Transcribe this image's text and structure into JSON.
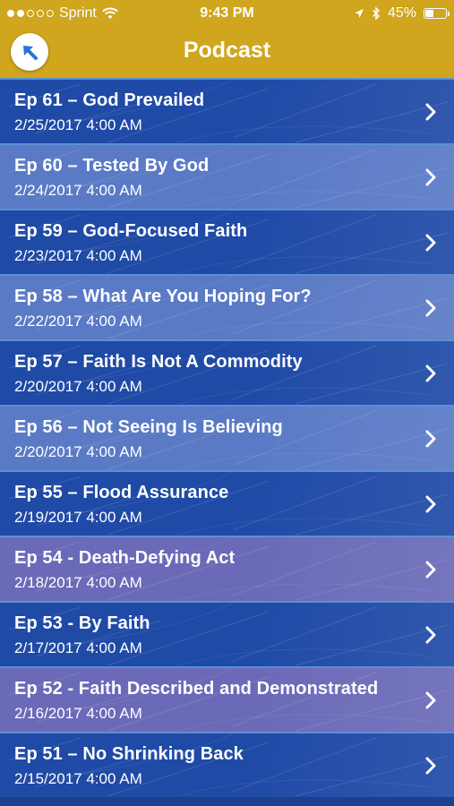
{
  "status_bar": {
    "carrier": "Sprint",
    "time": "9:43 PM",
    "battery_percent": "45%",
    "battery_level": 0.45,
    "signal_dots_filled": 2,
    "signal_dots_total": 5
  },
  "nav": {
    "title": "Podcast",
    "back_icon": "arrow-up-left-icon"
  },
  "colors": {
    "header": "#cfa61d",
    "row_dark": "#1f4aa6",
    "row_light": "#5a7ac6",
    "row_purple": "#6a6ab8",
    "row_divider": "#5c8fd6",
    "text": "#ffffff"
  },
  "episodes": [
    {
      "title": "Ep 61 – God Prevailed",
      "date": "2/25/2017 4:00 AM",
      "shade": "dark"
    },
    {
      "title": "Ep 60 – Tested By God",
      "date": "2/24/2017 4:00 AM",
      "shade": "light"
    },
    {
      "title": "Ep 59 – God-Focused Faith",
      "date": "2/23/2017 4:00 AM",
      "shade": "dark"
    },
    {
      "title": "Ep 58 – What Are You Hoping For?",
      "date": "2/22/2017 4:00 AM",
      "shade": "light"
    },
    {
      "title": "Ep 57 – Faith Is Not A Commodity",
      "date": "2/20/2017 4:00 AM",
      "shade": "dark"
    },
    {
      "title": "Ep 56 – Not Seeing Is Believing",
      "date": "2/20/2017 4:00 AM",
      "shade": "light"
    },
    {
      "title": "Ep 55 – Flood Assurance",
      "date": "2/19/2017 4:00 AM",
      "shade": "dark"
    },
    {
      "title": "Ep 54 - Death-Defying Act",
      "date": "2/18/2017 4:00 AM",
      "shade": "purple"
    },
    {
      "title": "Ep 53 - By Faith",
      "date": "2/17/2017 4:00 AM",
      "shade": "dark"
    },
    {
      "title": "Ep 52 - Faith Described and Demonstrated",
      "date": "2/16/2017 4:00 AM",
      "shade": "purple"
    },
    {
      "title": "Ep 51 – No Shrinking Back",
      "date": "2/15/2017 4:00 AM",
      "shade": "dark"
    }
  ]
}
